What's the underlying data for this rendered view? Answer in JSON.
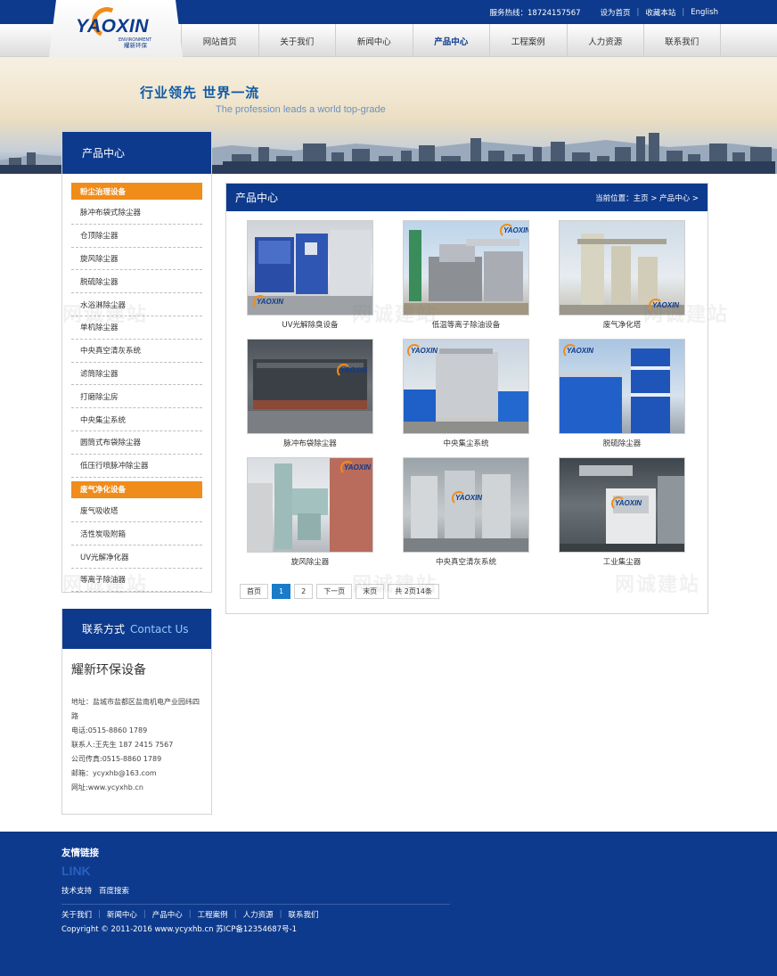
{
  "topbar": {
    "hotline": "服务热线：18724157567",
    "links": [
      "设为首页",
      "收藏本站",
      "English"
    ]
  },
  "logo": {
    "text": "YAOXIN",
    "sub_en": "ENVIRONMENT",
    "sub_cn": "耀新环保"
  },
  "nav": {
    "items": [
      "网站首页",
      "关于我们",
      "新闻中心",
      "产品中心",
      "工程案例",
      "人力资源",
      "联系我们"
    ],
    "active_index": 3
  },
  "banner": {
    "title": "行业领先  世界一流",
    "subtitle": "The profession leads a world top-grade"
  },
  "sidebar": {
    "title": "产品中心",
    "categories": [
      {
        "label": "粉尘治理设备",
        "items": [
          "脉冲布袋式除尘器",
          "仓顶除尘器",
          "旋风除尘器",
          "脱硫除尘器",
          "水浴淋除尘器",
          "单机除尘器",
          "中央真空清灰系统",
          "滤筒除尘器",
          "打磨除尘房",
          "中央集尘系统",
          "圆筒式布袋除尘器",
          "低压行喷脉冲除尘器"
        ]
      },
      {
        "label": "废气净化设备",
        "items": [
          "废气吸收塔",
          "活性炭吸附箱",
          "UV光解净化器",
          "等离子除油器"
        ]
      }
    ]
  },
  "contact": {
    "title": "联系方式",
    "title_en": "Contact Us",
    "company": "耀新环保设备",
    "lines": [
      "地址：盐城市盐都区盐南机电产业园纬四路",
      "电话:0515-8860 1789",
      "联系人:王先生 187 2415 7567",
      "公司传真:0515-8860 1789",
      "邮箱：ycyxhb@163.com",
      "网址:www.ycyxhb.cn"
    ]
  },
  "main": {
    "title": "产品中心",
    "breadcrumb": "当前位置：主页 > 产品中心 >",
    "products": [
      {
        "label": "UV光解除臭设备",
        "theme": "blue-cabinets"
      },
      {
        "label": "低温等离子除油设备",
        "theme": "scaffold"
      },
      {
        "label": "废气净化塔",
        "theme": "towers"
      },
      {
        "label": "脉冲布袋除尘器",
        "theme": "long-unit"
      },
      {
        "label": "中央集尘系统",
        "theme": "blue-building"
      },
      {
        "label": "脱硫除尘器",
        "theme": "blue-tower"
      },
      {
        "label": "旋风除尘器",
        "theme": "cyclone"
      },
      {
        "label": "中央真空清灰系统",
        "theme": "tanks"
      },
      {
        "label": "工业集尘器",
        "theme": "indoor-unit"
      }
    ],
    "thumb_logo": "YAOXIN",
    "pager": {
      "first": "首页",
      "pages": [
        "1",
        "2"
      ],
      "current": "1",
      "next": "下一页",
      "last": "末页",
      "info": "共 2页14条"
    }
  },
  "watermark": "网诚建站",
  "footer": {
    "friend_title": "友情链接",
    "friend_en": "LINK",
    "friend_links": [
      "技术支持",
      "百度搜索"
    ],
    "nav": [
      "关于我们",
      "新闻中心",
      "产品中心",
      "工程案例",
      "人力资源",
      "联系我们"
    ],
    "copyright": "Copyright © 2011-2016 www.ycyxhb.cn 苏ICP备12354687号-1"
  },
  "colors": {
    "brand_blue": "#0d3a8c",
    "accent_orange": "#f08c1a",
    "pager_active": "#1a7cc9"
  }
}
